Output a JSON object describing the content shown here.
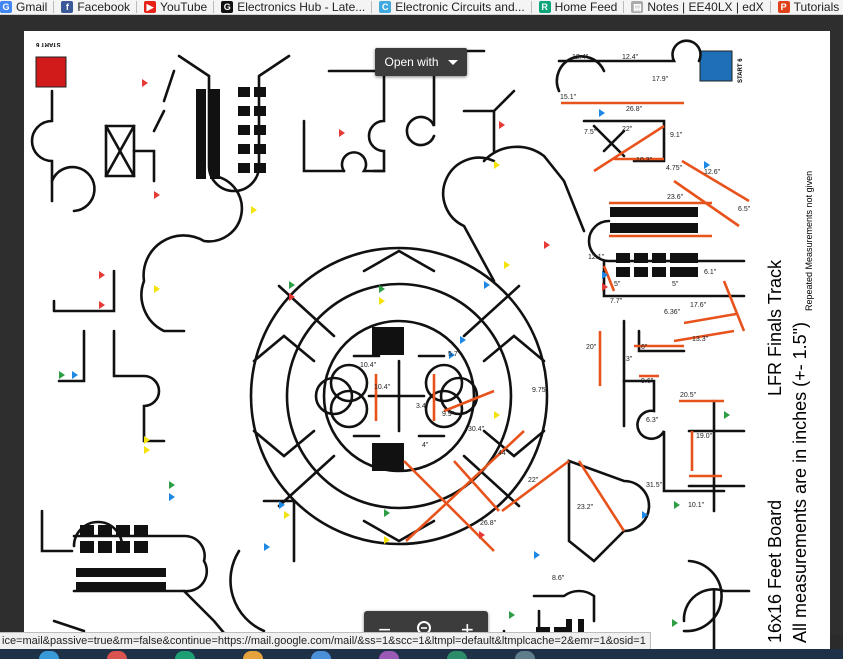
{
  "bookmarks": [
    {
      "label": "Gmail",
      "icon": "google-icon",
      "color": "#4285f4",
      "glyph": "G"
    },
    {
      "label": "Facebook",
      "icon": "facebook-icon",
      "color": "#3b5998",
      "glyph": "f"
    },
    {
      "label": "YouTube",
      "icon": "youtube-icon",
      "color": "#e62117",
      "glyph": "▶"
    },
    {
      "label": "Electronics Hub - Late...",
      "icon": "electronics-hub-icon",
      "color": "#111111",
      "glyph": "G"
    },
    {
      "label": "Electronic Circuits and...",
      "icon": "circuits-icon",
      "color": "#3fa9e0",
      "glyph": "C"
    },
    {
      "label": "Home Feed",
      "icon": "researchgate-icon",
      "color": "#0ca47a",
      "glyph": "R"
    },
    {
      "label": "Notes | EE40LX | edX",
      "icon": "notes-icon",
      "color": "#aaaaaa",
      "glyph": "▤"
    },
    {
      "label": "Tutorials - learn",
      "icon": "tutorials-icon",
      "color": "#e0421b",
      "glyph": "P"
    }
  ],
  "viewer": {
    "open_with_label": "Open with",
    "zoom_out_glyph": "−",
    "zoom_in_glyph": "+"
  },
  "status_url": "ice=mail&passive=true&rm=false&continue=https://mail.google.com/mail/&ss=1&scc=1&ltmpl=default&ltmplcache=2&emr=1&osid=1",
  "track": {
    "title_line1": "16x16 Feet Board",
    "title_line2": "All measurements are in inches (+- 1.5\")",
    "title_right": "LFR Finals Track",
    "note": "Repeated Measurements not given",
    "start_label": "START 6",
    "finish_label": "START 6",
    "measurements": [
      "12.4\"",
      "12.4\"",
      "17.9\"",
      "15.1\"",
      "26.8\"",
      "7.5\"",
      "22\"",
      "9.1\"",
      "10.3\"",
      "4.75\"",
      "12.6\"",
      "23.6\"",
      "6.5\"",
      "12.1\"",
      "5\"",
      "5\"",
      "6.1\"",
      "7.7\"",
      "6.36\"",
      "17.6\"",
      "13.3\"",
      "20\"",
      "6\"",
      "13\"",
      "9.6\"",
      "20.5\"",
      "6.3\"",
      "19.0\"",
      "31.5\"",
      "10.1\"",
      "10.4\"",
      "5.7\"",
      "9.75\"",
      "10.4\"",
      "9.9\"",
      "3.4\"",
      "4\"",
      "30.4\"",
      "44\"",
      "22\"",
      "23.2\"",
      "26.8\"",
      "8.6\""
    ]
  },
  "colors": {
    "start_box": "#d11a1a",
    "finish_box": "#1f6fb8",
    "measure_line": "#e8531c",
    "marker_red": "#e53935",
    "marker_green": "#2e9e44",
    "marker_blue": "#1e88e5",
    "marker_yellow": "#f4e20c",
    "taskbar": "#1f3147"
  }
}
